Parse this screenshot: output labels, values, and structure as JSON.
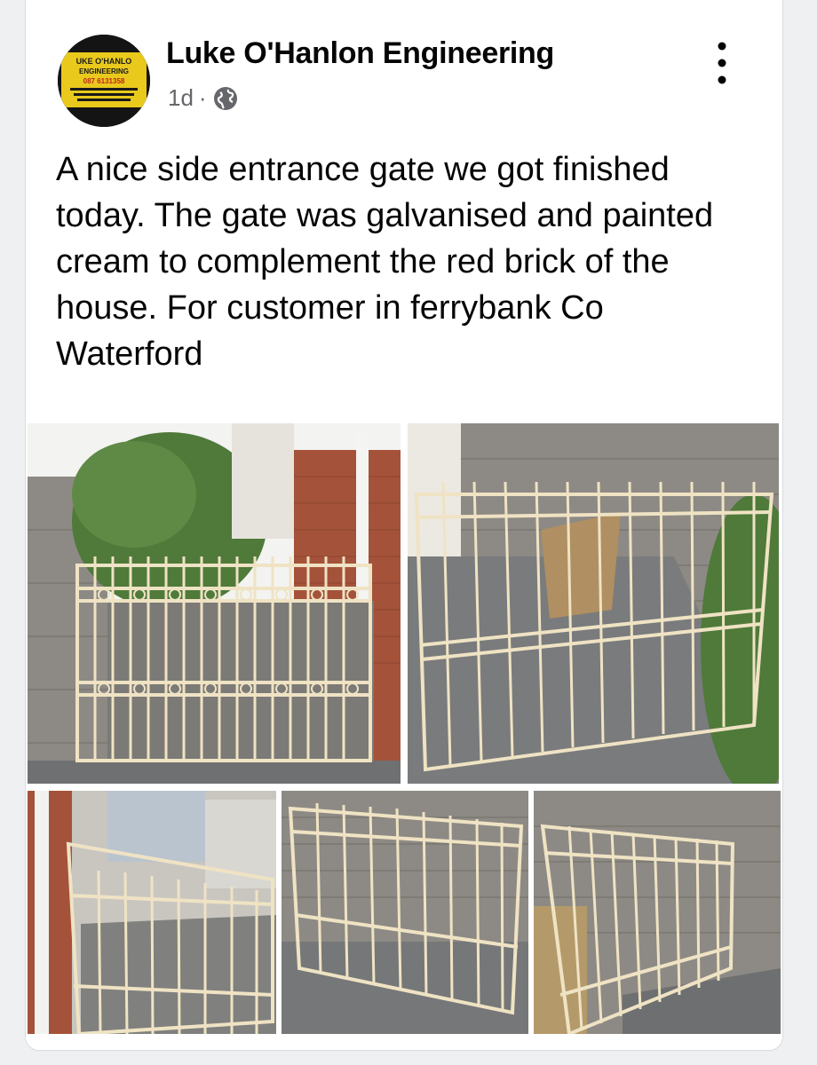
{
  "post": {
    "author": "Luke O'Hanlon Engineering",
    "timestamp": "1d",
    "separator": "·",
    "audience_icon": "globe-icon",
    "menu_icon": "more-options-icon",
    "text": "A nice side entrance gate we got finished today. The gate was galvanised and painted cream to complement the red brick of the house. For customer in ferrybank Co Waterford"
  },
  "avatar": {
    "line1": "UKE O'HANLO",
    "line2": "ENGINEERING",
    "line3": "087 6131358"
  },
  "photos": [
    {
      "id": "photo-1",
      "icon": "gate-photo"
    },
    {
      "id": "photo-2",
      "icon": "gate-photo"
    },
    {
      "id": "photo-3",
      "icon": "gate-photo"
    },
    {
      "id": "photo-4",
      "icon": "gate-photo"
    },
    {
      "id": "photo-5",
      "icon": "gate-photo"
    }
  ],
  "colors": {
    "gate_cream": "#efe3c4",
    "brick_red": "#a4533a",
    "block_grey": "#8d8a85",
    "ground_grey": "#6f7072",
    "foliage_green": "#4f7a3a",
    "text_primary": "#050505",
    "text_secondary": "#65676b"
  }
}
